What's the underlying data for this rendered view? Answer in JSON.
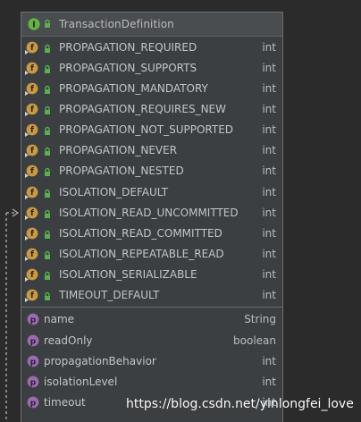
{
  "interface": {
    "name": "TransactionDefinition",
    "icon": "interface-icon",
    "visibility_icon": "public-lock-icon"
  },
  "fields": [
    {
      "name": "PROPAGATION_REQUIRED",
      "type": "int",
      "icon": "field-icon"
    },
    {
      "name": "PROPAGATION_SUPPORTS",
      "type": "int",
      "icon": "field-icon"
    },
    {
      "name": "PROPAGATION_MANDATORY",
      "type": "int",
      "icon": "field-icon"
    },
    {
      "name": "PROPAGATION_REQUIRES_NEW",
      "type": "int",
      "icon": "field-icon"
    },
    {
      "name": "PROPAGATION_NOT_SUPPORTED",
      "type": "int",
      "icon": "field-icon"
    },
    {
      "name": "PROPAGATION_NEVER",
      "type": "int",
      "icon": "field-icon"
    },
    {
      "name": "PROPAGATION_NESTED",
      "type": "int",
      "icon": "field-icon"
    },
    {
      "name": "ISOLATION_DEFAULT",
      "type": "int",
      "icon": "field-icon"
    },
    {
      "name": "ISOLATION_READ_UNCOMMITTED",
      "type": "int",
      "icon": "field-icon"
    },
    {
      "name": "ISOLATION_READ_COMMITTED",
      "type": "int",
      "icon": "field-icon"
    },
    {
      "name": "ISOLATION_REPEATABLE_READ",
      "type": "int",
      "icon": "field-icon"
    },
    {
      "name": "ISOLATION_SERIALIZABLE",
      "type": "int",
      "icon": "field-icon"
    },
    {
      "name": "TIMEOUT_DEFAULT",
      "type": "int",
      "icon": "field-icon"
    }
  ],
  "properties": [
    {
      "name": "name",
      "type": "String",
      "icon": "property-icon"
    },
    {
      "name": "readOnly",
      "type": "boolean",
      "icon": "property-icon"
    },
    {
      "name": "propagationBehavior",
      "type": "int",
      "icon": "property-icon"
    },
    {
      "name": "isolationLevel",
      "type": "int",
      "icon": "property-icon"
    },
    {
      "name": "timeout",
      "type": "int",
      "icon": "property-icon"
    }
  ],
  "watermark": "https://blog.csdn.net/yinlongfei_love",
  "colors": {
    "canvas_background": "#2b2b2b",
    "card_background": "#3c3f41",
    "header_background": "#4a4d50",
    "border": "#6b6d6f",
    "interface_icon": "#62b543",
    "field_icon": "#ca9a43",
    "property_icon": "#9b6bb2",
    "visibility_icon": "#59b04f"
  }
}
